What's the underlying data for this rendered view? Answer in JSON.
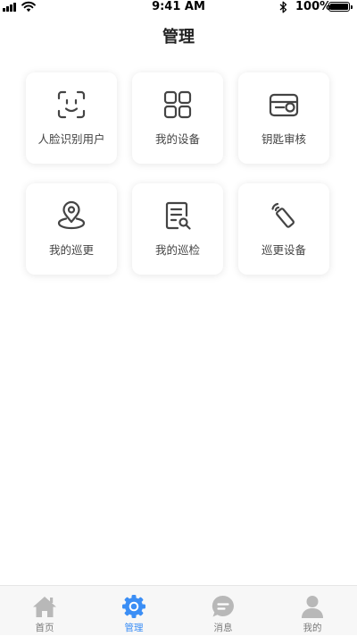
{
  "status_bar": {
    "time": "9:41 AM",
    "battery_percent": "100%",
    "battery_level": 1.0,
    "icons": [
      "signal-icon",
      "wifi-icon",
      "bluetooth-icon",
      "battery-icon"
    ]
  },
  "header": {
    "title": "管理"
  },
  "grid": {
    "items": [
      {
        "label": "人脸识别用户",
        "icon": "face-scan-icon"
      },
      {
        "label": "我的设备",
        "icon": "grid-apps-icon"
      },
      {
        "label": "钥匙审核",
        "icon": "key-card-icon"
      },
      {
        "label": "我的巡更",
        "icon": "location-pin-icon"
      },
      {
        "label": "我的巡检",
        "icon": "document-search-icon"
      },
      {
        "label": "巡更设备",
        "icon": "wireless-stick-icon"
      }
    ],
    "icon_color": "#444444"
  },
  "tab_bar": {
    "active_index": 1,
    "active_color": "#3b8ef5",
    "inactive_color": "#b8b8b8",
    "items": [
      {
        "label": "首页",
        "icon": "home-icon"
      },
      {
        "label": "管理",
        "icon": "gear-icon"
      },
      {
        "label": "消息",
        "icon": "chat-bubble-icon"
      },
      {
        "label": "我的",
        "icon": "person-icon"
      }
    ]
  }
}
